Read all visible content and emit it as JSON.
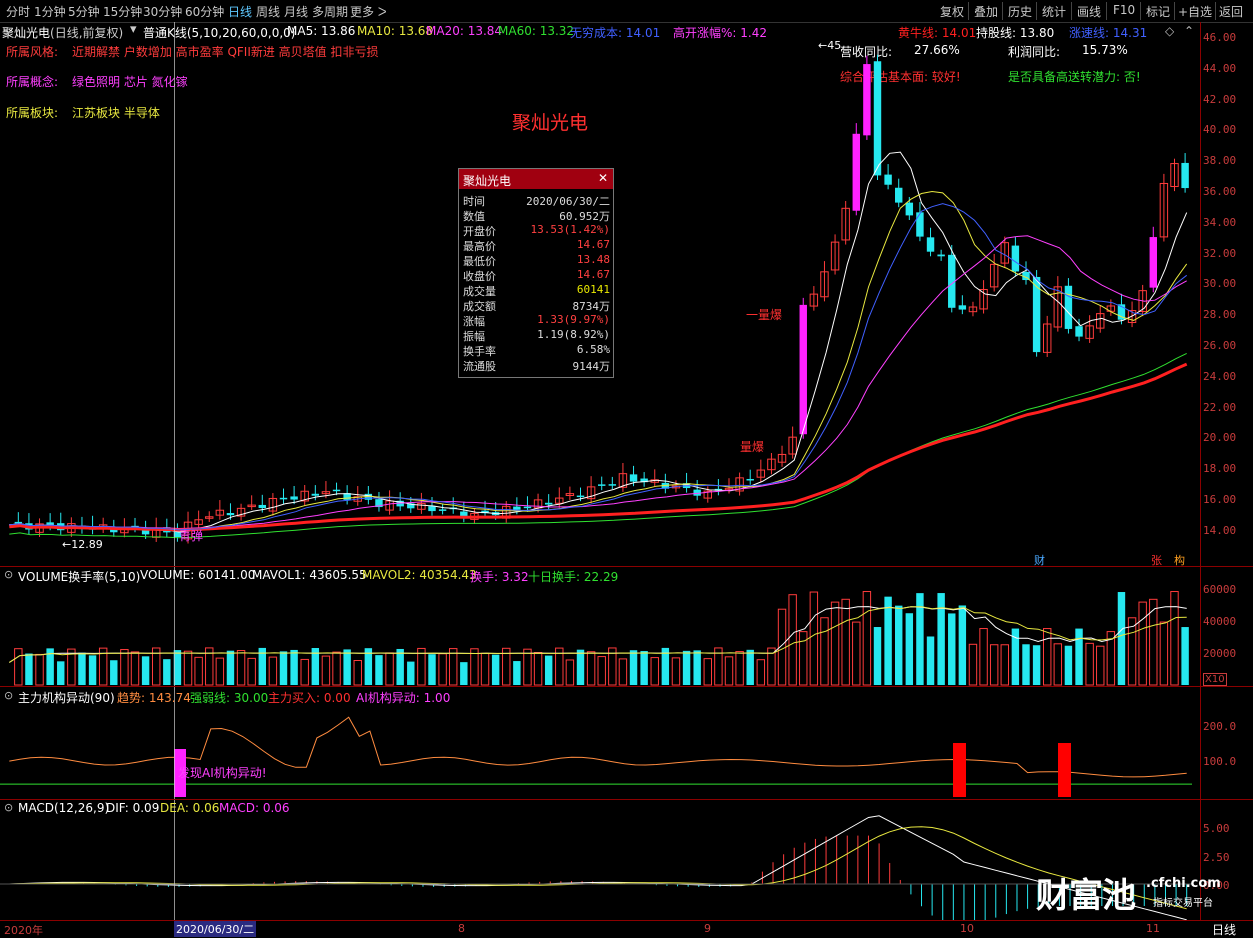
{
  "toolbar": {
    "timeframes": [
      "分时",
      "1分钟",
      "5分钟",
      "15分钟",
      "30分钟",
      "60分钟",
      "日线",
      "周线",
      "月线",
      "多周期",
      "更多 ᐳ"
    ],
    "active": "日线",
    "right_buttons": [
      "复权",
      "叠加",
      "历史",
      "统计",
      "画线",
      "F10",
      "标记",
      "+自选",
      "返回"
    ]
  },
  "stock": {
    "name": "聚灿光电",
    "mode": "(日线,前复权)",
    "main_indicator": "普通K线(5,10,20,60,0,0,0)",
    "ma5": "MA5: 13.86",
    "ma10": "MA10: 13.68",
    "ma20": "MA20: 13.84",
    "ma60": "MA60: 13.32",
    "cost": "无穷成本: 14.01",
    "open_rise": "高开涨幅%: 1.42",
    "bull_line": "黄牛线: 14.01",
    "hold_line": "持股线: 13.80",
    "stop_line": "涨速线: 14.31"
  },
  "info": {
    "style_label": "所属风格:",
    "style_value": "近期解禁 户数增加 高市盈率 QFII新进 高贝塔值 扣非亏损",
    "concept_label": "所属概念:",
    "concept_value": "绿色照明 芯片 氮化镓",
    "sector_label": "所属板块:",
    "sector_value": "江苏板块  半导体",
    "big_title": "聚灿光电",
    "growth_label": "营收同比:",
    "growth_value": "27.66%",
    "profit_label": "利润同比:",
    "profit_value": "15.73%",
    "eval_text": "综合评估基本面: 较好!",
    "dividend_text": "是否具备高送转潜力: 否!"
  },
  "popup": {
    "title": "聚灿光电",
    "close": "✕",
    "rows": [
      {
        "k": "时间",
        "v": "2020/06/30/二",
        "c": "#dddddd"
      },
      {
        "k": "数值",
        "v": "60.952万",
        "c": "#dddddd"
      },
      {
        "k": "开盘价",
        "v": "13.53(1.42%)",
        "c": "#ff4040"
      },
      {
        "k": "最高价",
        "v": "14.67",
        "c": "#ff4040"
      },
      {
        "k": "最低价",
        "v": "13.48",
        "c": "#ff4040"
      },
      {
        "k": "收盘价",
        "v": "14.67",
        "c": "#ff4040"
      },
      {
        "k": "成交量",
        "v": "60141",
        "c": "#e8e800"
      },
      {
        "k": "成交额",
        "v": "8734万",
        "c": "#dddddd"
      },
      {
        "k": "涨幅",
        "v": "1.33(9.97%)",
        "c": "#ff4040"
      },
      {
        "k": "振幅",
        "v": "1.19(8.92%)",
        "c": "#dddddd"
      },
      {
        "k": "换手率",
        "v": "6.58%",
        "c": "#dddddd"
      },
      {
        "k": "流通股",
        "v": "9144万",
        "c": "#dddddd"
      }
    ]
  },
  "price_axis": [
    "46.00",
    "44.00",
    "42.00",
    "40.00",
    "38.00",
    "36.00",
    "34.00",
    "32.00",
    "30.00",
    "28.00",
    "26.00",
    "24.00",
    "22.00",
    "20.00",
    "18.00",
    "16.00",
    "14.00"
  ],
  "annotations": {
    "low_mark": "←12.89",
    "high_mark": "←45.",
    "buy1": "青弹",
    "big1": "一量爆",
    "big2": "量爆",
    "tag_cai": "财",
    "tag_zhang": "张",
    "tag_gou": "构"
  },
  "volume_panel": {
    "title": "VOLUME换手率(5,10)",
    "volume": "VOLUME: 60141.00",
    "mavol1": "MAVOL1: 43605.55",
    "mavol2": "MAVOL2: 40354.43",
    "turnover": "换手: 3.32",
    "turnover10": "十日换手: 22.29",
    "axis": [
      "60000",
      "40000",
      "20000"
    ],
    "unit": "X10"
  },
  "inst_panel": {
    "title": "主力机构异动(90)",
    "trend": "趋势: 143.74",
    "strong": "强弱线: 30.00",
    "buy": "主力买入: 0.00",
    "ai": "AI机构异动: 1.00",
    "axis": [
      "200.0",
      "100.0"
    ],
    "note": "发现AI机构异动!"
  },
  "macd_panel": {
    "title": "MACD(12,26,9)",
    "dif": "DIF: 0.09",
    "dea": "DEA: 0.06",
    "macd": "MACD: 0.06",
    "axis": [
      "5.00",
      "2.50",
      "0.00"
    ]
  },
  "date_axis": {
    "labels": [
      "2020年",
      "2020/06/30/二",
      "8",
      "9",
      "10",
      "11"
    ],
    "period": "日线"
  },
  "watermark": {
    "brand": "财富池",
    "site": ".cfchi.com",
    "sub": "指标交易平台"
  },
  "colors": {
    "up": "#ff3c3c",
    "down": "#26e8f0",
    "limit": "#ff22ff",
    "ma5": "#ffffff",
    "ma10": "#e8e840",
    "ma20": "#ff40ff",
    "ma60": "#30e030",
    "bull": "#ff2020",
    "hold": "#4060ff"
  }
}
